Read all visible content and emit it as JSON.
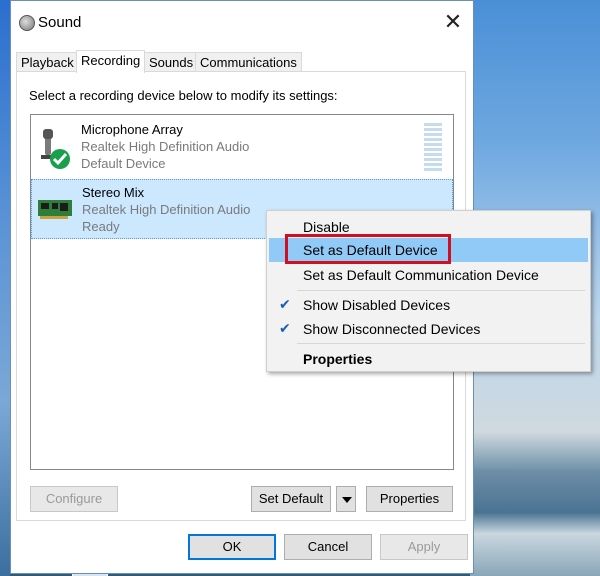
{
  "window": {
    "title": "Sound",
    "close_glyph": "✕"
  },
  "tabs": [
    {
      "label": "Playback",
      "active": false
    },
    {
      "label": "Recording",
      "active": true
    },
    {
      "label": "Sounds",
      "active": false
    },
    {
      "label": "Communications",
      "active": false
    }
  ],
  "panel": {
    "instruction": "Select a recording device below to modify its settings:"
  },
  "devices": [
    {
      "name": "Microphone Array",
      "driver": "Realtek High Definition Audio",
      "status": "Default Device",
      "icon": "microphone-icon",
      "is_default": true,
      "selected": false
    },
    {
      "name": "Stereo Mix",
      "driver": "Realtek High Definition Audio",
      "status": "Ready",
      "icon": "sound-card-icon",
      "is_default": false,
      "selected": true
    }
  ],
  "buttons": {
    "configure": "Configure",
    "set_default": "Set Default",
    "properties": "Properties",
    "ok": "OK",
    "cancel": "Cancel",
    "apply": "Apply"
  },
  "context_menu": {
    "items": [
      {
        "label": "Disable",
        "checked": false,
        "hovered": false,
        "bold": false
      },
      {
        "label": "Set as Default Device",
        "checked": false,
        "hovered": true,
        "bold": false
      },
      {
        "label": "Set as Default Communication Device",
        "checked": false,
        "hovered": false,
        "bold": false
      },
      {
        "label": "Show Disabled Devices",
        "checked": true,
        "hovered": false,
        "bold": false
      },
      {
        "label": "Show Disconnected Devices",
        "checked": true,
        "hovered": false,
        "bold": false
      },
      {
        "label": "Properties",
        "checked": false,
        "hovered": false,
        "bold": true
      }
    ],
    "check_glyph": "✔"
  },
  "colors": {
    "selection": "#cce8ff",
    "menu_hover": "#91c9f7",
    "highlight_box": "#d01020",
    "check": "#1a5fb4"
  }
}
